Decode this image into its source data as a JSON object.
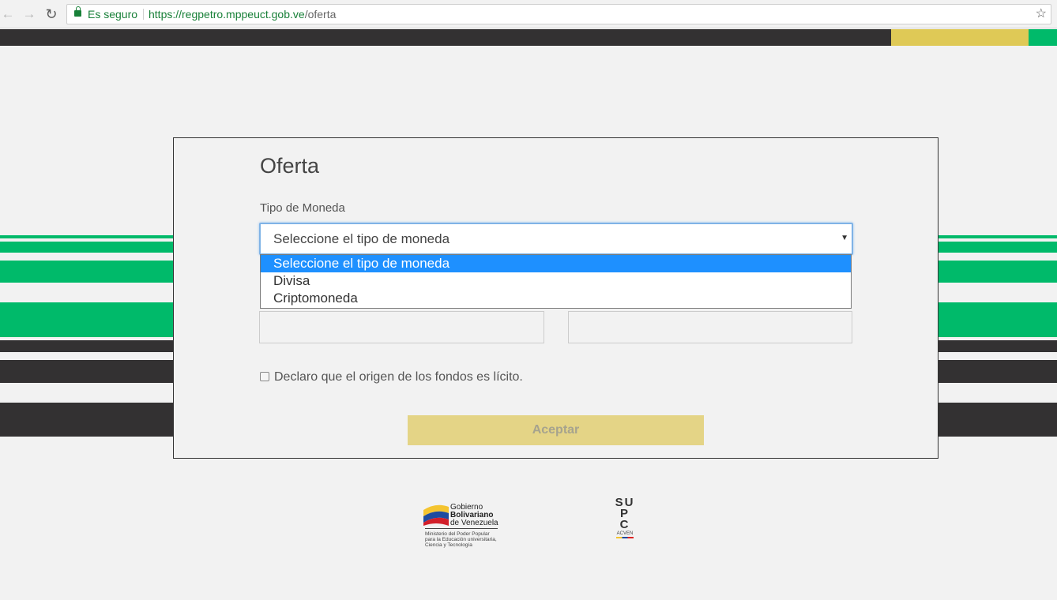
{
  "browser": {
    "secure_label": "Es seguro",
    "url_host": "https://regpetro.mppeuct.gob.ve",
    "url_path": "/oferta",
    "icons": [
      "back-arrow-icon",
      "forward-arrow-icon",
      "reload-icon",
      "lock-icon",
      "star-icon"
    ]
  },
  "form": {
    "title": "Oferta",
    "currency_label": "Tipo de Moneda",
    "currency_selected": "Seleccione el tipo de moneda",
    "currency_options": [
      "Seleccione el tipo de moneda",
      "Divisa",
      "Criptomoneda"
    ],
    "declaration_label": "Declaro que el origen de los fondos es lícito.",
    "declaration_checked": false,
    "accept_label": "Aceptar"
  },
  "footer": {
    "gob_line1": "Gobierno",
    "gob_line2": "Bolivariano",
    "gob_line3": "de Venezuela",
    "gob_sub1": "Ministerio del Poder Popular",
    "gob_sub2": "para la Educación universitaria,",
    "gob_sub3": "Ciencia y Tecnología",
    "supc_s": "S",
    "supc_u": "U",
    "supc_p": "P",
    "supc_c": "C",
    "supc_sub": "ACVEN"
  },
  "colors": {
    "dark": "#333132",
    "green": "#00ba6a",
    "yellow": "#dfc956",
    "accept_bg": "#e4d486",
    "option_highlight": "#1e90ff"
  }
}
